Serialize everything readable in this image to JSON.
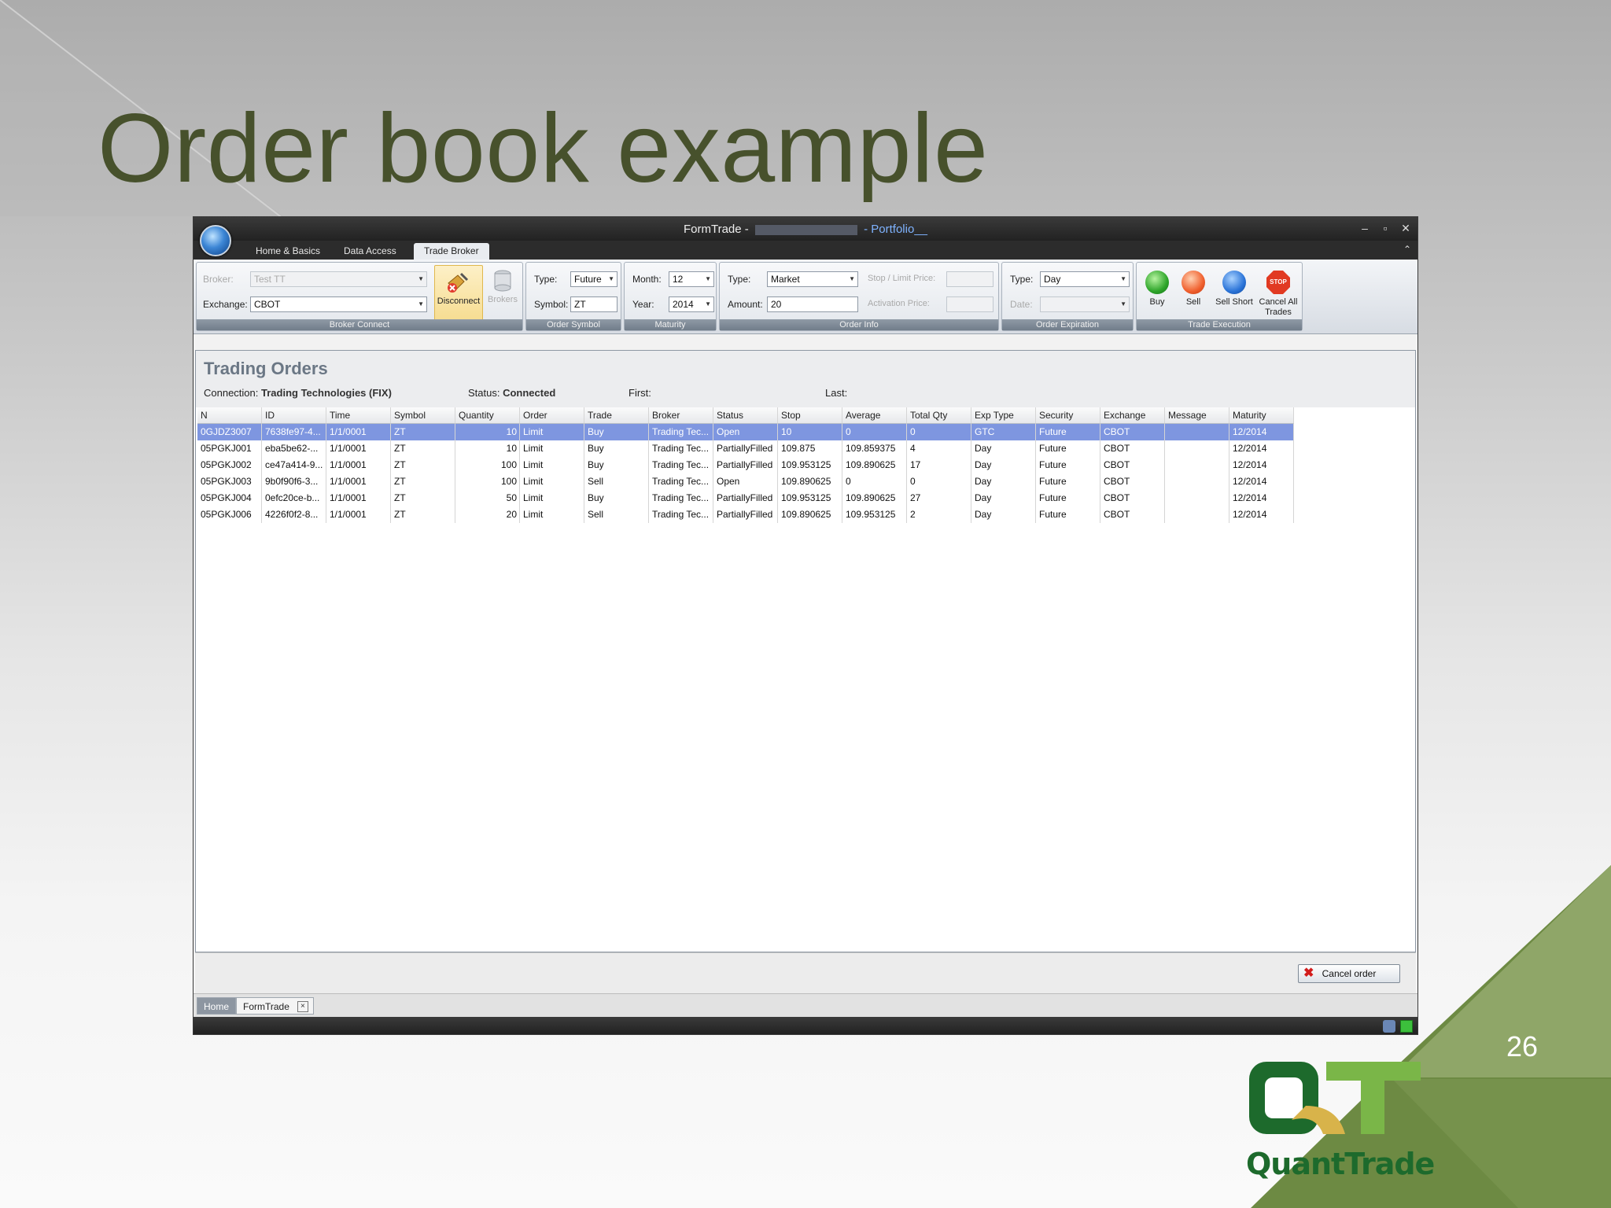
{
  "slide": {
    "title": "Order book example",
    "page_number": "26"
  },
  "logo": {
    "letters": "QT",
    "name": "QuantTrade",
    "colors": {
      "dark_green": "#1d6a2c",
      "light_green": "#7ab648",
      "gold": "#d8b34a"
    }
  },
  "window": {
    "title_prefix": "FormTrade -",
    "title_suffix": "- Portfolio__",
    "controls": {
      "minimize": "–",
      "restore": "▫",
      "close": "✕"
    },
    "tabs": [
      "Home & Basics",
      "Data Access",
      "Trade Broker"
    ],
    "active_tab": "Trade Broker"
  },
  "ribbon": {
    "broker_connect": {
      "broker_label": "Broker:",
      "broker_value": "Test TT",
      "exchange_label": "Exchange:",
      "exchange_value": "CBOT",
      "disconnect": "Disconnect",
      "brokers": "Brokers",
      "group": "Broker Connect"
    },
    "order_symbol": {
      "type_label": "Type:",
      "type_value": "Future",
      "symbol_label": "Symbol:",
      "symbol_value": "ZT",
      "group": "Order Symbol"
    },
    "maturity": {
      "month_label": "Month:",
      "month_value": "12",
      "year_label": "Year:",
      "year_value": "2014",
      "group": "Maturity"
    },
    "order_info": {
      "type_label": "Type:",
      "type_value": "Market",
      "amount_label": "Amount:",
      "amount_value": "20",
      "stop_label": "Stop / Limit Price:",
      "activation_label": "Activation Price:",
      "group": "Order Info"
    },
    "order_expiration": {
      "type_label": "Type:",
      "type_value": "Day",
      "date_label": "Date:",
      "group": "Order Expiration"
    },
    "trade_execution": {
      "buy": "Buy",
      "sell": "Sell",
      "sell_short": "Sell Short",
      "cancel_all_1": "Cancel All",
      "cancel_all_2": "Trades",
      "stop_text": "STOP",
      "group": "Trade Execution"
    }
  },
  "panel": {
    "title": "Trading Orders",
    "connection_label": "Connection:",
    "connection_value": "Trading Technologies (FIX)",
    "status_label": "Status:",
    "status_value": "Connected",
    "first_label": "First:",
    "last_label": "Last:"
  },
  "grid": {
    "columns": [
      "N",
      "ID",
      "Time",
      "Symbol",
      "Quantity",
      "Order",
      "Trade",
      "Broker",
      "Status",
      "Stop",
      "Average",
      "Total Qty",
      "Exp Type",
      "Security",
      "Exchange",
      "Message",
      "Maturity"
    ],
    "rows": [
      [
        "0GJDZ3007",
        "7638fe97-4...",
        "1/1/0001",
        "ZT",
        "10",
        "Limit",
        "Buy",
        "Trading Tec...",
        "Open",
        "10",
        "0",
        "0",
        "GTC",
        "Future",
        "CBOT",
        "",
        "12/2014"
      ],
      [
        "05PGKJ001",
        "eba5be62-...",
        "1/1/0001",
        "ZT",
        "10",
        "Limit",
        "Buy",
        "Trading Tec...",
        "PartiallyFilled",
        "109.875",
        "109.859375",
        "4",
        "Day",
        "Future",
        "CBOT",
        "",
        "12/2014"
      ],
      [
        "05PGKJ002",
        "ce47a414-9...",
        "1/1/0001",
        "ZT",
        "100",
        "Limit",
        "Buy",
        "Trading Tec...",
        "PartiallyFilled",
        "109.953125",
        "109.890625",
        "17",
        "Day",
        "Future",
        "CBOT",
        "",
        "12/2014"
      ],
      [
        "05PGKJ003",
        "9b0f90f6-3...",
        "1/1/0001",
        "ZT",
        "100",
        "Limit",
        "Sell",
        "Trading Tec...",
        "Open",
        "109.890625",
        "0",
        "0",
        "Day",
        "Future",
        "CBOT",
        "",
        "12/2014"
      ],
      [
        "05PGKJ004",
        "0efc20ce-b...",
        "1/1/0001",
        "ZT",
        "50",
        "Limit",
        "Buy",
        "Trading Tec...",
        "PartiallyFilled",
        "109.953125",
        "109.890625",
        "27",
        "Day",
        "Future",
        "CBOT",
        "",
        "12/2014"
      ],
      [
        "05PGKJ006",
        "4226f0f2-8...",
        "1/1/0001",
        "ZT",
        "20",
        "Limit",
        "Sell",
        "Trading Tec...",
        "PartiallyFilled",
        "109.890625",
        "109.953125",
        "2",
        "Day",
        "Future",
        "CBOT",
        "",
        "12/2014"
      ]
    ],
    "selected_row": 0
  },
  "actions": {
    "cancel_order": "Cancel order"
  },
  "doc_tabs": {
    "home": "Home",
    "formtrade": "FormTrade",
    "close": "×"
  },
  "colors": {
    "title_olive": "#47512c",
    "selection": "#7e96e0",
    "corner_green": "#6d8a43"
  }
}
